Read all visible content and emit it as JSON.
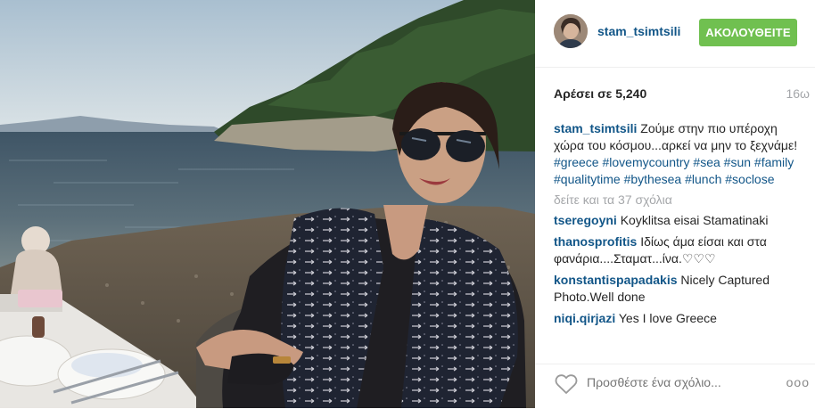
{
  "post": {
    "username": "stam_tsimtsili",
    "follow_label": "ΑΚΟΛΟΥΘΕΙΤΕ",
    "likes": "Αρέσει σε 5,240",
    "time_ago": "16ω"
  },
  "caption": {
    "user": "stam_tsimtsili",
    "text": "Ζούμε στην πιο υπέροχη χώρα του κόσμου...αρκεί να μην το ξεχνάμε!",
    "hashtags": [
      "#greece",
      "#lovemycountry",
      "#sea",
      "#sun",
      "#family",
      "#qualitytime",
      "#bythesea",
      "#lunch",
      "#soclose"
    ]
  },
  "view_all": "δείτε και τα 37 σχόλια",
  "comments": [
    {
      "user": "tseregoyni",
      "text": "Koyklitsa eisai Stamatinaki"
    },
    {
      "user": "thanosprofitis",
      "text": "Ιδίως άμα είσαι και στα φανάρια....Σταματ...ίνα.♡♡♡"
    },
    {
      "user": "konstantispapadakis",
      "text": "Nicely Captured Photo.Well done"
    },
    {
      "user": "niqi.qirjazi",
      "text": "Yes I love Greece"
    }
  ],
  "footer": {
    "placeholder": "Προσθέστε ένα σχόλιο...",
    "more": "ooo"
  },
  "icons": {
    "like": "heart-outline-icon",
    "options": "more-options-icon"
  },
  "colors": {
    "link": "#125688",
    "follow": "#70c050",
    "muted": "#a5a7aa"
  }
}
